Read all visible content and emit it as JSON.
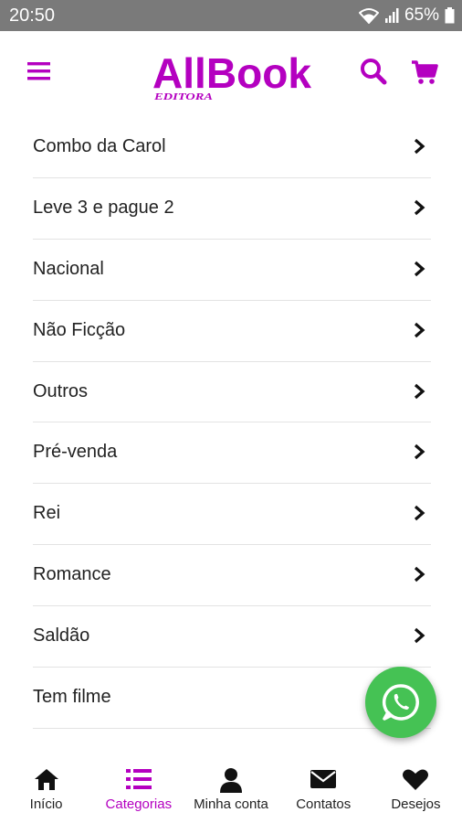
{
  "status_bar": {
    "time": "20:50",
    "battery": "65%"
  },
  "header": {
    "logo_main": "AllBook",
    "logo_sub": "EDITORA"
  },
  "categories": [
    {
      "label": "Combo da Carol"
    },
    {
      "label": "Leve 3 e pague 2"
    },
    {
      "label": "Nacional"
    },
    {
      "label": "Não Ficção"
    },
    {
      "label": "Outros"
    },
    {
      "label": "Pré-venda"
    },
    {
      "label": "Rei"
    },
    {
      "label": "Romance"
    },
    {
      "label": "Saldão"
    },
    {
      "label": "Tem filme"
    }
  ],
  "bottom_nav": [
    {
      "label": "Início",
      "icon": "home-icon"
    },
    {
      "label": "Categorias",
      "icon": "list-icon",
      "active": true
    },
    {
      "label": "Minha conta",
      "icon": "user-icon"
    },
    {
      "label": "Contatos",
      "icon": "envelope-icon"
    },
    {
      "label": "Desejos",
      "icon": "heart-icon"
    }
  ],
  "colors": {
    "accent": "#b400c0",
    "whatsapp": "#45c254",
    "status_bar": "#7a7a7a"
  }
}
